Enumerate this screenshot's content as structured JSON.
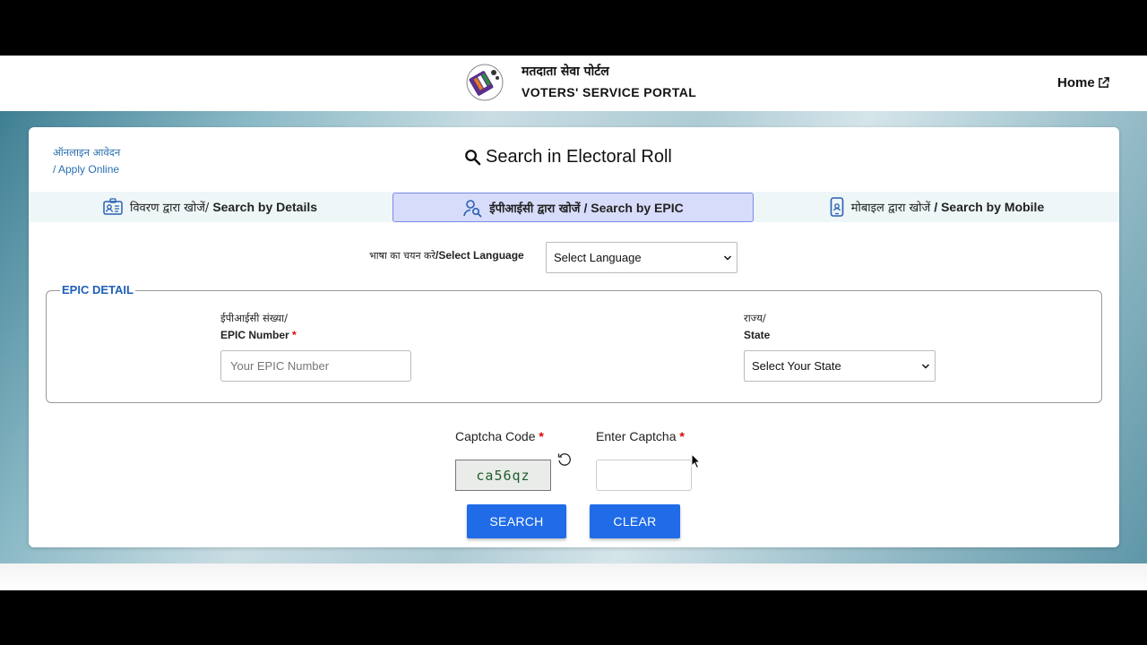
{
  "header": {
    "title_hi": "मतदाता सेवा पोर्टल",
    "title_en": "VOTERS' SERVICE PORTAL",
    "home_label": "Home"
  },
  "card": {
    "apply_online_hi": "ऑनलाइन आवेदन",
    "apply_online_en": "/ Apply Online",
    "title": "Search in Electoral Roll"
  },
  "tabs": [
    {
      "label_hi": "विवरण द्वारा खोजें/",
      "label_en": "Search by Details",
      "icon": "id-card-icon",
      "active": false
    },
    {
      "label_hi": "ईपीआईसी द्वारा खोजें",
      "label_en": "/ Search by EPIC",
      "icon": "user-search-icon",
      "active": true
    },
    {
      "label_hi": "मोबाइल द्वारा खोजें",
      "label_en": "/ Search by Mobile",
      "icon": "mobile-phone-icon",
      "active": false
    }
  ],
  "language": {
    "label_hi": "भाषा का चयन करे",
    "label_en": "/Select Language",
    "selected": "Select Language"
  },
  "epic_detail": {
    "legend": "EPIC DETAIL",
    "epic_label_hi": "ईपीआईसी संख्या/",
    "epic_label_en": "EPIC Number",
    "epic_placeholder": "Your EPIC Number",
    "state_label_hi": "राज्य/",
    "state_label_en": "State",
    "state_selected": "Select Your State"
  },
  "captcha": {
    "code_label": "Captcha Code",
    "enter_label": "Enter Captcha",
    "code_value": "ca56qz",
    "required_mark": "*"
  },
  "buttons": {
    "search": "SEARCH",
    "clear": "CLEAR"
  },
  "colors": {
    "primary_button": "#1f6be8",
    "active_tab": "#d7dcfb",
    "link": "#2a6fb0",
    "legend": "#1f5fb8"
  }
}
